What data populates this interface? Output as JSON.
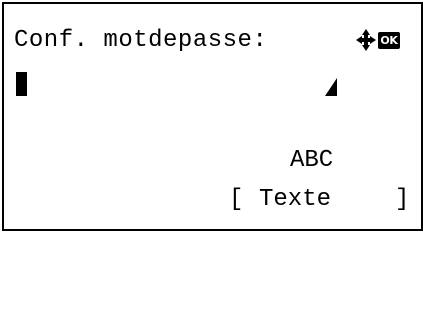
{
  "screen": {
    "title": "Conf. motdepasse:",
    "ok_label": "OK",
    "input_value": "",
    "input_mode": "ABC",
    "softkey_label": "Texte"
  },
  "icons": {
    "nav": "four-way-arrow-icon",
    "ok": "ok-icon",
    "signal": "signal-strength-icon"
  }
}
